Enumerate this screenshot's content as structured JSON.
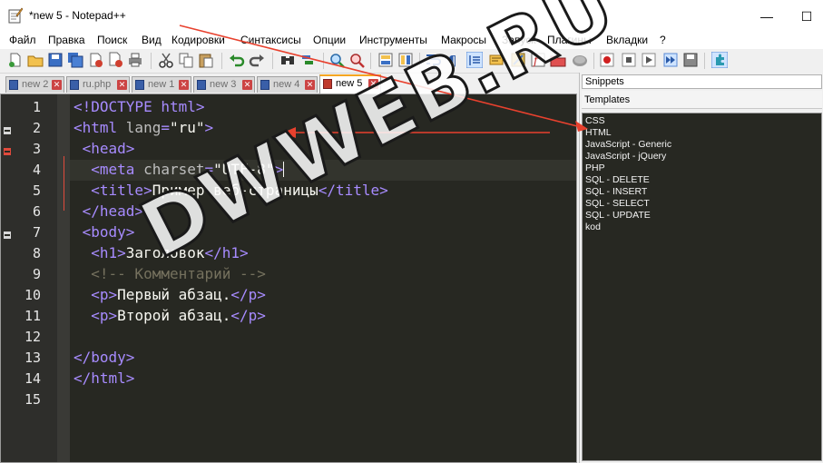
{
  "window": {
    "title": "*new 5 - Notepad++",
    "minimize_glyph": "—",
    "maximize_glyph": "☐"
  },
  "menu": [
    "Файл",
    "Правка",
    "Поиск",
    "Вид",
    "Кодировки",
    "Синтаксисы",
    "Опции",
    "Инструменты",
    "Макросы",
    "Запуск",
    "Плагины",
    "Вкладки",
    "?"
  ],
  "tabs": [
    {
      "label": "new 2",
      "active": false
    },
    {
      "label": "ru.php",
      "active": false
    },
    {
      "label": "new 1",
      "active": false
    },
    {
      "label": "new 3",
      "active": false
    },
    {
      "label": "new 4",
      "active": false
    },
    {
      "label": "new 5",
      "active": true
    }
  ],
  "editor": {
    "line_numbers": [
      "1",
      "2",
      "3",
      "4",
      "5",
      "6",
      "7",
      "8",
      "9",
      "10",
      "11",
      "12",
      "13",
      "14",
      "15"
    ],
    "current_line": 4
  },
  "panel": {
    "title": "Snippets",
    "subtitle": "Templates",
    "items": [
      "CSS",
      "HTML",
      "JavaScript - Generic",
      "JavaScript - jQuery",
      "PHP",
      "SQL - DELETE",
      "SQL - INSERT",
      "SQL - SELECT",
      "SQL - UPDATE",
      "kod"
    ]
  },
  "watermark": "DWWEB.RU",
  "colors": {
    "editor_bg": "#272822",
    "tag": "#a78bff",
    "comment": "#75715e",
    "arrow": "#e8412e",
    "active_tab_accent": "#f5a623"
  }
}
